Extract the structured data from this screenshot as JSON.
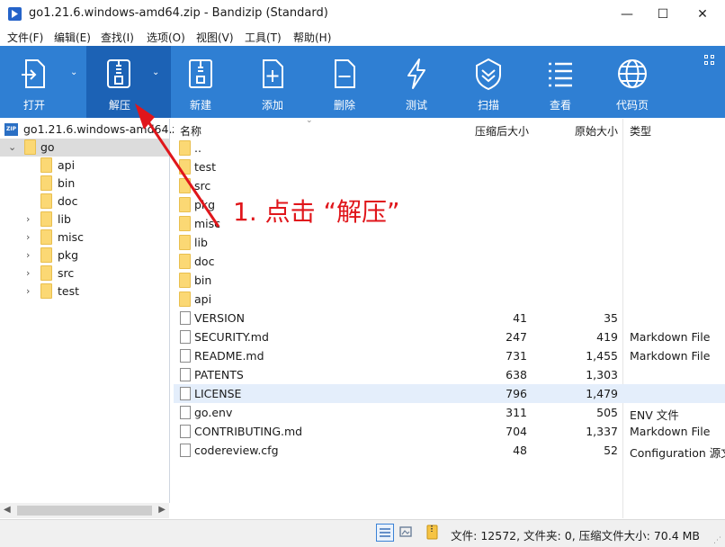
{
  "window": {
    "title": "go1.21.6.windows-amd64.zip - Bandizip (Standard)",
    "minimize": "—",
    "maximize": "☐",
    "close": "✕"
  },
  "menu": [
    "文件(F)",
    "编辑(E)",
    "查找(I)",
    "选项(O)",
    "视图(V)",
    "工具(T)",
    "帮助(H)"
  ],
  "toolbar": {
    "open": "打开",
    "extract": "解压",
    "new": "新建",
    "add": "添加",
    "delete": "删除",
    "test": "测试",
    "scan": "扫描",
    "view": "查看",
    "codepage": "代码页"
  },
  "icons": {
    "open": "open-archive-icon",
    "extract": "extract-zipper-icon",
    "new": "new-archive-icon",
    "add": "add-file-icon",
    "delete": "delete-file-icon",
    "test": "lightning-icon",
    "scan": "shield-check-icon",
    "view": "list-view-icon",
    "codepage": "globe-icon",
    "grid": "grid-icon",
    "folder": "folder-icon",
    "file": "file-icon",
    "zip": "zip-icon"
  },
  "tree": {
    "root": "go1.21.6.windows-amd64.zi",
    "zip_badge": "ZIP",
    "items": [
      {
        "label": "go",
        "expanded": true
      },
      {
        "label": "api"
      },
      {
        "label": "bin"
      },
      {
        "label": "doc"
      },
      {
        "label": "lib",
        "has_children": true
      },
      {
        "label": "misc",
        "has_children": true
      },
      {
        "label": "pkg",
        "has_children": true
      },
      {
        "label": "src",
        "has_children": true
      },
      {
        "label": "test",
        "has_children": true
      }
    ]
  },
  "columns": {
    "name": "名称",
    "compressed": "压缩后大小",
    "original": "原始大小",
    "type": "类型"
  },
  "files": [
    {
      "name": "..",
      "kind": "folder",
      "compressed": "",
      "original": "",
      "type": ""
    },
    {
      "name": "test",
      "kind": "folder",
      "compressed": "",
      "original": "",
      "type": ""
    },
    {
      "name": "src",
      "kind": "folder",
      "compressed": "",
      "original": "",
      "type": ""
    },
    {
      "name": "pkg",
      "kind": "folder",
      "compressed": "",
      "original": "",
      "type": ""
    },
    {
      "name": "misc",
      "kind": "folder",
      "compressed": "",
      "original": "",
      "type": ""
    },
    {
      "name": "lib",
      "kind": "folder",
      "compressed": "",
      "original": "",
      "type": ""
    },
    {
      "name": "doc",
      "kind": "folder",
      "compressed": "",
      "original": "",
      "type": ""
    },
    {
      "name": "bin",
      "kind": "folder",
      "compressed": "",
      "original": "",
      "type": ""
    },
    {
      "name": "api",
      "kind": "folder",
      "compressed": "",
      "original": "",
      "type": ""
    },
    {
      "name": "VERSION",
      "kind": "file",
      "compressed": "41",
      "original": "35",
      "type": ""
    },
    {
      "name": "SECURITY.md",
      "kind": "file",
      "compressed": "247",
      "original": "419",
      "type": "Markdown File"
    },
    {
      "name": "README.md",
      "kind": "file",
      "compressed": "731",
      "original": "1,455",
      "type": "Markdown File"
    },
    {
      "name": "PATENTS",
      "kind": "file",
      "compressed": "638",
      "original": "1,303",
      "type": ""
    },
    {
      "name": "LICENSE",
      "kind": "file",
      "compressed": "796",
      "original": "1,479",
      "type": "",
      "selected": true
    },
    {
      "name": "go.env",
      "kind": "file",
      "compressed": "311",
      "original": "505",
      "type": "ENV 文件"
    },
    {
      "name": "CONTRIBUTING.md",
      "kind": "file",
      "compressed": "704",
      "original": "1,337",
      "type": "Markdown File"
    },
    {
      "name": "codereview.cfg",
      "kind": "file",
      "compressed": "48",
      "original": "52",
      "type": "Configuration 源文"
    }
  ],
  "status": {
    "text": "文件: 12572, 文件夹: 0, 压缩文件大小: 70.4 MB"
  },
  "annotation": {
    "text": "1. 点击 “解压”"
  },
  "colors": {
    "toolbar": "#2f7fd3",
    "toolbar_selected": "#1c62b5",
    "annotation": "#e0161b",
    "folder": "#fbd874"
  }
}
